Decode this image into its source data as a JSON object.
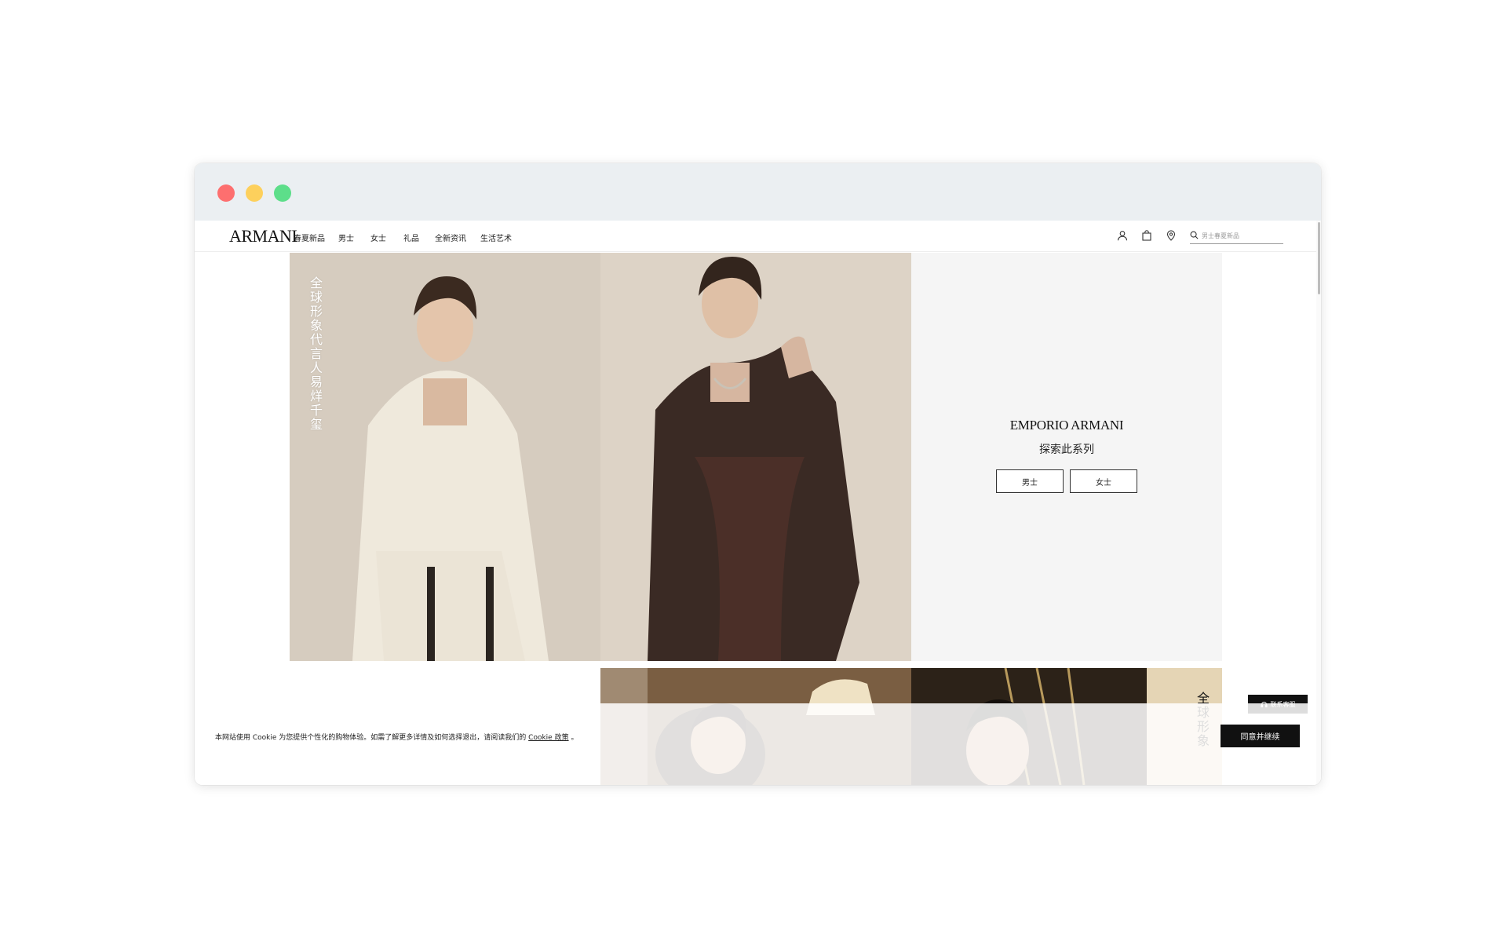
{
  "window": {
    "controls": [
      "close",
      "minimize",
      "maximize"
    ]
  },
  "navbar": {
    "logo": "ARMANI",
    "items": [
      {
        "label": "春夏新品"
      },
      {
        "label": "男士"
      },
      {
        "label": "女士"
      },
      {
        "label": "礼品"
      },
      {
        "label": "全新资讯"
      },
      {
        "label": "生活艺术"
      }
    ],
    "icons": [
      "user-icon",
      "shopping-bag-icon",
      "location-pin-icon",
      "search-icon"
    ],
    "search": {
      "placeholder": "男士春夏新品"
    }
  },
  "hero": {
    "caption": "全球形象代言人 易烊千玺",
    "brand": "EMPORIO ARMANI",
    "collection_title": "探索此系列",
    "buttons": [
      {
        "label": "男士"
      },
      {
        "label": "女士"
      }
    ]
  },
  "second_banner": {
    "caption": "全球形象"
  },
  "contact": {
    "label": "联系客服",
    "icon": "headset-icon"
  },
  "cookie_banner": {
    "text": "本网站使用 Cookie 为您提供个性化的购物体验。如需了解更多详情及如何选择退出，请阅读我们的",
    "link_text": "Cookie 政策",
    "suffix": "。",
    "accept_label": "同意并继续"
  },
  "colors": {
    "traffic_red": "#fd6f6f",
    "traffic_yellow": "#fdd05c",
    "traffic_green": "#5dde8a",
    "button_dark": "#111111",
    "panel_bg": "#f5f5f5"
  }
}
